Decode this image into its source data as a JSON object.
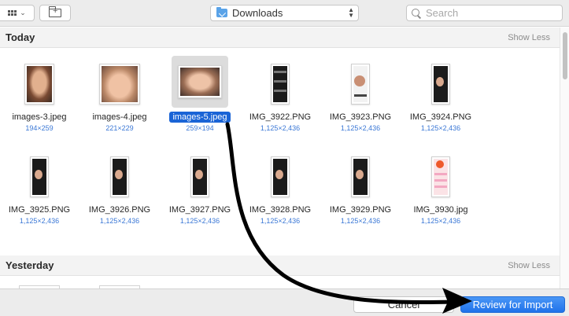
{
  "toolbar": {
    "location": "Downloads",
    "search_placeholder": "Search"
  },
  "sections": [
    {
      "title": "Today",
      "toggle": "Show Less",
      "items": [
        {
          "name": "images-3.jpeg",
          "dims": "194×259",
          "thumb": "photo-portrait",
          "selected": false
        },
        {
          "name": "images-4.jpeg",
          "dims": "221×229",
          "thumb": "photo-square",
          "selected": false
        },
        {
          "name": "images-5.jpeg",
          "dims": "259×194",
          "thumb": "photo-landscape",
          "selected": true
        },
        {
          "name": "IMG_3922.PNG",
          "dims": "1,125×2,436",
          "thumb": "phone-dark",
          "selected": false
        },
        {
          "name": "IMG_3923.PNG",
          "dims": "1,125×2,436",
          "thumb": "phone-light",
          "selected": false
        },
        {
          "name": "IMG_3924.PNG",
          "dims": "1,125×2,436",
          "thumb": "phone-dark",
          "selected": false
        },
        {
          "name": "IMG_3925.PNG",
          "dims": "1,125×2,436",
          "thumb": "phone-dark",
          "selected": false
        },
        {
          "name": "IMG_3926.PNG",
          "dims": "1,125×2,436",
          "thumb": "phone-dark",
          "selected": false
        },
        {
          "name": "IMG_3927.PNG",
          "dims": "1,125×2,436",
          "thumb": "phone-dark",
          "selected": false
        },
        {
          "name": "IMG_3928.PNG",
          "dims": "1,125×2,436",
          "thumb": "phone-dark",
          "selected": false
        },
        {
          "name": "IMG_3929.PNG",
          "dims": "1,125×2,436",
          "thumb": "phone-dark",
          "selected": false
        },
        {
          "name": "IMG_3930.jpg",
          "dims": "1,125×2,436",
          "thumb": "phone-pink",
          "selected": false
        }
      ]
    },
    {
      "title": "Yesterday",
      "toggle": "Show Less"
    }
  ],
  "buttons": {
    "cancel": "Cancel",
    "review": "Review for Import"
  },
  "colors": {
    "accent": "#1a64d6",
    "dims_text": "#3b78d6",
    "annotation_arrow": "#000000"
  }
}
